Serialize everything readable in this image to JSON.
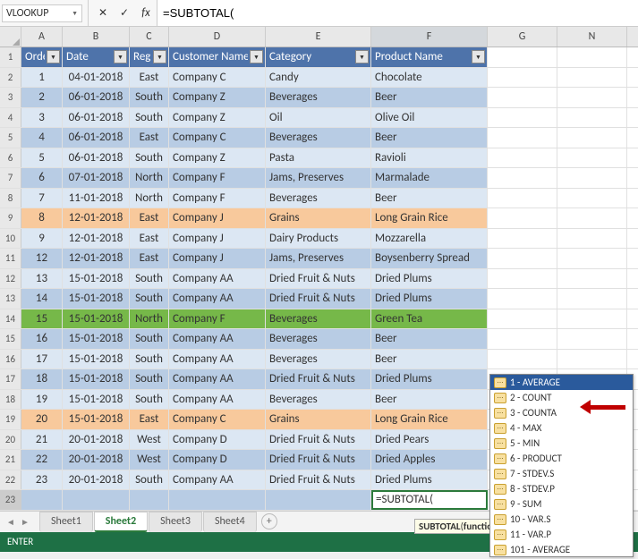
{
  "formula_bar": {
    "name_box": "VLOOKUP",
    "formula": "=SUBTOTAL("
  },
  "columns": [
    "A",
    "B",
    "C",
    "D",
    "E",
    "F",
    "G",
    "N"
  ],
  "headers": [
    "Order",
    "Date",
    "Region",
    "Customer Name",
    "Category",
    "Product Name"
  ],
  "rows": [
    {
      "n": 2,
      "band": "light",
      "order": "1",
      "date": "04-01-2018",
      "region": "East",
      "cust": "Company C",
      "cat": "Candy",
      "prod": "Chocolate"
    },
    {
      "n": 3,
      "band": "dark",
      "order": "2",
      "date": "06-01-2018",
      "region": "South",
      "cust": "Company Z",
      "cat": "Beverages",
      "prod": "Beer"
    },
    {
      "n": 4,
      "band": "light",
      "order": "3",
      "date": "06-01-2018",
      "region": "South",
      "cust": "Company Z",
      "cat": "Oil",
      "prod": "Olive Oil"
    },
    {
      "n": 5,
      "band": "dark",
      "order": "4",
      "date": "06-01-2018",
      "region": "East",
      "cust": "Company C",
      "cat": "Beverages",
      "prod": "Beer"
    },
    {
      "n": 6,
      "band": "light",
      "order": "5",
      "date": "06-01-2018",
      "region": "South",
      "cust": "Company Z",
      "cat": "Pasta",
      "prod": "Ravioli"
    },
    {
      "n": 7,
      "band": "dark",
      "order": "6",
      "date": "07-01-2018",
      "region": "North",
      "cust": "Company F",
      "cat": "Jams, Preserves",
      "prod": "Marmalade"
    },
    {
      "n": 8,
      "band": "light",
      "order": "7",
      "date": "11-01-2018",
      "region": "North",
      "cust": "Company F",
      "cat": "Beverages",
      "prod": "Beer"
    },
    {
      "n": 9,
      "band": "orange",
      "order": "8",
      "date": "12-01-2018",
      "region": "East",
      "cust": "Company J",
      "cat": "Grains",
      "prod": "Long Grain Rice"
    },
    {
      "n": 10,
      "band": "light",
      "order": "9",
      "date": "12-01-2018",
      "region": "East",
      "cust": "Company J",
      "cat": "Dairy Products",
      "prod": "Mozzarella"
    },
    {
      "n": 11,
      "band": "dark",
      "order": "12",
      "date": "12-01-2018",
      "region": "East",
      "cust": "Company J",
      "cat": "Jams, Preserves",
      "prod": "Boysenberry Spread"
    },
    {
      "n": 12,
      "band": "light",
      "order": "13",
      "date": "15-01-2018",
      "region": "South",
      "cust": "Company AA",
      "cat": "Dried Fruit & Nuts",
      "prod": "Dried Plums"
    },
    {
      "n": 13,
      "band": "dark",
      "order": "14",
      "date": "15-01-2018",
      "region": "South",
      "cust": "Company AA",
      "cat": "Dried Fruit & Nuts",
      "prod": "Dried Plums"
    },
    {
      "n": 14,
      "band": "green",
      "order": "15",
      "date": "15-01-2018",
      "region": "North",
      "cust": "Company F",
      "cat": "Beverages",
      "prod": "Green Tea"
    },
    {
      "n": 15,
      "band": "dark",
      "order": "16",
      "date": "15-01-2018",
      "region": "South",
      "cust": "Company AA",
      "cat": "Beverages",
      "prod": "Beer"
    },
    {
      "n": 16,
      "band": "light",
      "order": "17",
      "date": "15-01-2018",
      "region": "South",
      "cust": "Company AA",
      "cat": "Beverages",
      "prod": "Beer"
    },
    {
      "n": 17,
      "band": "dark",
      "order": "18",
      "date": "15-01-2018",
      "region": "South",
      "cust": "Company AA",
      "cat": "Dried Fruit & Nuts",
      "prod": "Dried Plums"
    },
    {
      "n": 18,
      "band": "light",
      "order": "19",
      "date": "15-01-2018",
      "region": "South",
      "cust": "Company AA",
      "cat": "Beverages",
      "prod": "Beer"
    },
    {
      "n": 19,
      "band": "orange",
      "order": "20",
      "date": "15-01-2018",
      "region": "East",
      "cust": "Company C",
      "cat": "Grains",
      "prod": "Long Grain Rice"
    },
    {
      "n": 20,
      "band": "light",
      "order": "21",
      "date": "20-01-2018",
      "region": "West",
      "cust": "Company D",
      "cat": "Dried Fruit & Nuts",
      "prod": "Dried Pears"
    },
    {
      "n": 21,
      "band": "dark",
      "order": "22",
      "date": "20-01-2018",
      "region": "West",
      "cust": "Company D",
      "cat": "Dried Fruit & Nuts",
      "prod": "Dried Apples"
    },
    {
      "n": 22,
      "band": "light",
      "order": "23",
      "date": "20-01-2018",
      "region": "South",
      "cust": "Company AA",
      "cat": "Dried Fruit & Nuts",
      "prod": "Dried Plums"
    }
  ],
  "active_cell": {
    "row": 23,
    "text": "=SUBTOTAL("
  },
  "dropdown": {
    "items": [
      "1 - AVERAGE",
      "2 - COUNT",
      "3 - COUNTA",
      "4 - MAX",
      "5 - MIN",
      "6 - PRODUCT",
      "7 - STDEV.S",
      "8 - STDEV.P",
      "9 - SUM",
      "10 - VAR.S",
      "11 - VAR.P",
      "101 - AVERAGE"
    ],
    "selected_index": 0
  },
  "tooltip": "SUBTOTAL(function_n",
  "sheets": {
    "tabs": [
      "Sheet1",
      "Sheet2",
      "Sheet3",
      "Sheet4"
    ],
    "active_index": 1
  },
  "status": "ENTER"
}
